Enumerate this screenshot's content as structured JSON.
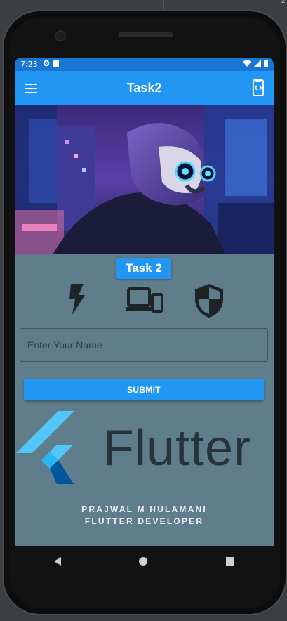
{
  "ide": {
    "corner_text": "2"
  },
  "statusbar": {
    "time": "7:23"
  },
  "appbar": {
    "title": "Task2"
  },
  "task_button": {
    "label": "Task 2"
  },
  "icons": [
    "flash-icon",
    "devices-icon",
    "security-shield-icon"
  ],
  "name_field": {
    "placeholder": "Enter Your Name",
    "value": ""
  },
  "submit": {
    "label": "SUBMIT"
  },
  "logo": {
    "wordmark": "Flutter"
  },
  "credit": {
    "line1": "PRAJWAL M HULAMANI",
    "line2": "FLUTTER DEVELOPER"
  },
  "colors": {
    "primary": "#2196f3",
    "statusbar": "#1976d2",
    "background": "#607d8b",
    "icon": "#1c2428",
    "flutter_light": "#54c5f8",
    "flutter_dark": "#01579b"
  }
}
